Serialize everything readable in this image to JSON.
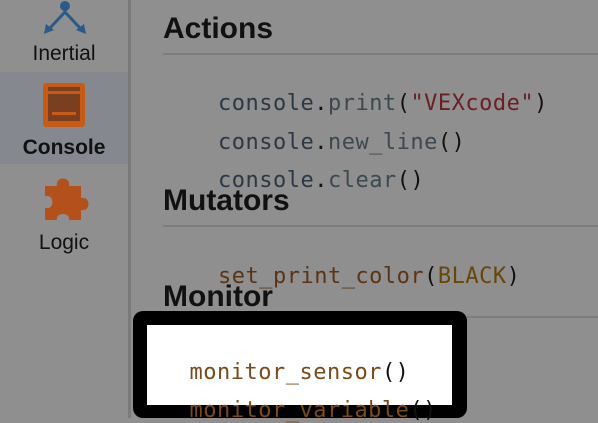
{
  "sidebar": {
    "items": [
      {
        "label": "Inertial",
        "icon": "inertial-icon",
        "selected": false
      },
      {
        "label": "Console",
        "icon": "console-icon",
        "selected": true
      },
      {
        "label": "Logic",
        "icon": "puzzle-icon",
        "selected": false
      }
    ]
  },
  "sections": {
    "actions": {
      "title": "Actions",
      "lines": [
        {
          "obj": "console",
          "dot": ".",
          "fn": "print",
          "open": "(",
          "arg": "\"VEXcode\"",
          "close": ")"
        },
        {
          "obj": "console",
          "dot": ".",
          "fn": "new_line",
          "open": "(",
          "arg": "",
          "close": ")"
        },
        {
          "obj": "console",
          "dot": ".",
          "fn": "clear",
          "open": "(",
          "arg": "",
          "close": ")"
        }
      ]
    },
    "mutators": {
      "title": "Mutators",
      "lines": [
        {
          "fn": "set_print_color",
          "open": "(",
          "arg": "BLACK",
          "close": ")"
        }
      ]
    },
    "monitor": {
      "title": "Monitor",
      "lines": [
        {
          "fn": "monitor_sensor",
          "parens": "()"
        },
        {
          "fn": "monitor_variable",
          "parens": "()"
        }
      ]
    }
  },
  "colors": {
    "highlight_frame": "#000000",
    "console_icon": "#c85a14",
    "logic_icon": "#b4501c",
    "inertial_icon": "#2a5a88"
  }
}
